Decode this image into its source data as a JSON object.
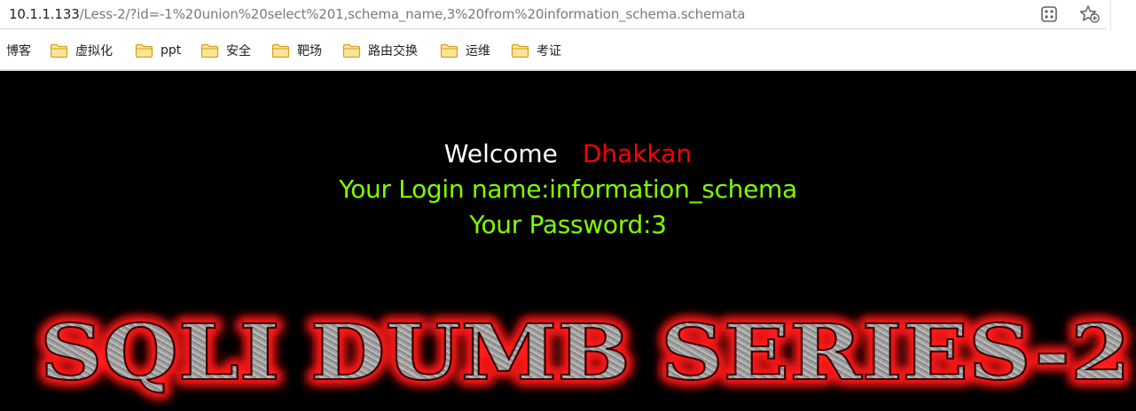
{
  "browser": {
    "url_host": "10.1.1.133",
    "url_path": "/Less-2/?id=-1%20union%20select%201,schema_name,3%20from%20information_schema.schemata",
    "icons": {
      "reader": "qr-grid-icon",
      "favorite": "star-add-icon"
    }
  },
  "bookmarks": {
    "items": [
      {
        "label": "博客",
        "icon": null
      },
      {
        "label": "虚拟化",
        "icon": "folder-icon"
      },
      {
        "label": "ppt",
        "icon": "folder-icon"
      },
      {
        "label": "安全",
        "icon": "folder-icon"
      },
      {
        "label": "靶场",
        "icon": "folder-icon"
      },
      {
        "label": "路由交换",
        "icon": "folder-icon"
      },
      {
        "label": "运维",
        "icon": "folder-icon"
      },
      {
        "label": "考证",
        "icon": "folder-icon"
      }
    ]
  },
  "page": {
    "welcome": "Welcome",
    "user": "Dhakkan",
    "login_line": "Your Login name:information_schema",
    "password_line": "Your Password:3",
    "banner": "SQLI DUMB SERIES-2",
    "colors": {
      "background": "#000000",
      "welcome": "#ffffff",
      "user": "#ff0000",
      "result": "#7fff00",
      "banner_glow": "#ff1a1a"
    }
  }
}
